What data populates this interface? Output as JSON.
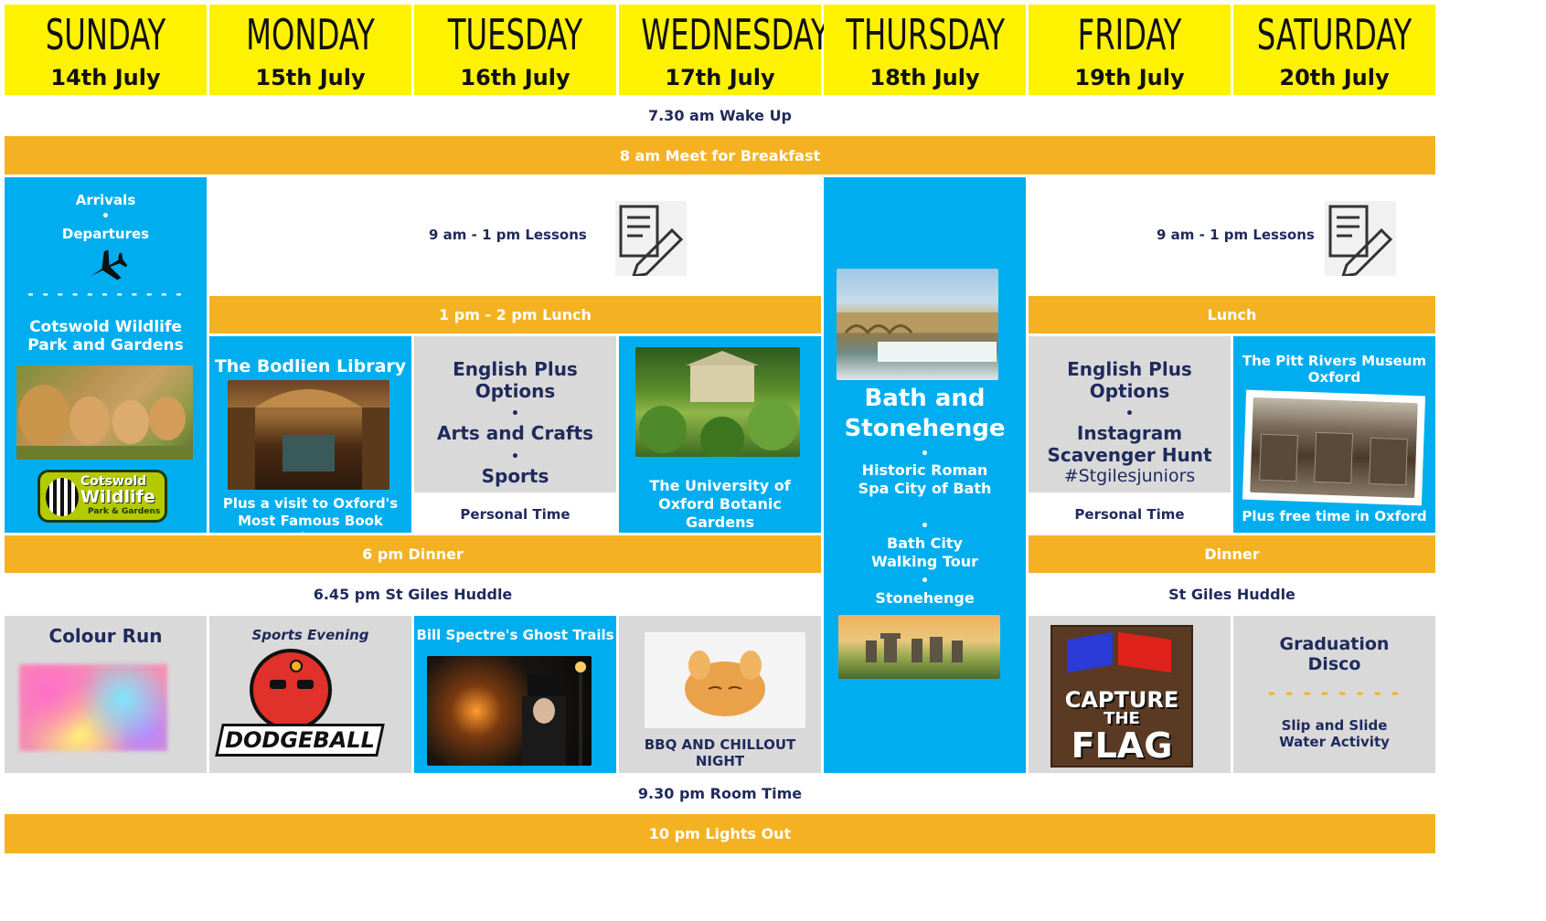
{
  "days": [
    {
      "name": "SUNDAY",
      "date": "14th July"
    },
    {
      "name": "MONDAY",
      "date": "15th July"
    },
    {
      "name": "TUESDAY",
      "date": "16th July"
    },
    {
      "name": "WEDNESDAY",
      "date": "17th July"
    },
    {
      "name": "THURSDAY",
      "date": "18th July"
    },
    {
      "name": "FRIDAY",
      "date": "19th July"
    },
    {
      "name": "SATURDAY",
      "date": "20th July"
    }
  ],
  "rows": {
    "wake": "7.30 am   Wake Up",
    "breakfast": "8 am   Meet for Breakfast",
    "lessons_left": "9 am - 1 pm  Lessons",
    "lessons_right": "9 am - 1 pm  Lessons",
    "lunch_left": "1 pm - 2 pm  Lunch",
    "lunch_right": "Lunch",
    "dinner_left": "6 pm Dinner",
    "dinner_right": "Dinner",
    "huddle_left": "6.45 pm St Giles Huddle",
    "huddle_right": "St Giles Huddle",
    "room": "9.30 pm  Room Time",
    "lights": "10 pm  Lights Out"
  },
  "sunday": {
    "arrivals": "Arrivals",
    "departures": "Departures",
    "dot": "•",
    "dashes": "- - - - - - - - - - -",
    "park": "Cotswold Wildlife Park and Gardens",
    "logo_line1": "Cotswold",
    "logo_line2": "Wildlife",
    "logo_line3": "Park & Gardens",
    "evening": "Colour Run"
  },
  "monday": {
    "title": "The Bodlien Library",
    "caption": "Plus a visit to Oxford's Most Famous Book Shop",
    "evening": "Sports Evening",
    "logo_text": "DODGEBALL"
  },
  "tuesday": {
    "opt1": "English Plus Options",
    "opt2": "Arts and Crafts",
    "opt3": "Sports",
    "dot": "•",
    "personal": "Personal Time",
    "evening": "Bill Spectre's Ghost Trails"
  },
  "wednesday": {
    "caption": "The University of Oxford Botanic Gardens",
    "evening": "BBQ AND CHILLOUT NIGHT"
  },
  "thursday": {
    "title": "Bath and Stonehenge",
    "item1": "Historic Roman Spa City of Bath",
    "item2": "Bath City Walking Tour",
    "item3": "Stonehenge",
    "dot": "•"
  },
  "friday": {
    "opt1": "English Plus Options",
    "opt2": "Instagram Scavenger Hunt",
    "tag": "#Stgilesjuniors",
    "dot": "•",
    "personal": "Personal Time",
    "flag_line1": "CAPTURE",
    "flag_line2": "THE",
    "flag_line3": "FLAG"
  },
  "saturday": {
    "title": "The Pitt Rivers Museum Oxford",
    "caption": "Plus free time in Oxford",
    "evening1": "Graduation Disco",
    "dashes": "- - - - - - - -",
    "evening2": "Slip and Slide Water Activity"
  },
  "colors": {
    "yellow": "#fff200",
    "orange": "#f4b223",
    "blue": "#00aeef",
    "grey": "#d9d9d9",
    "navy": "#1f2a5c"
  },
  "icons": [
    "airplane-icon",
    "lesson-sheet-icon"
  ]
}
